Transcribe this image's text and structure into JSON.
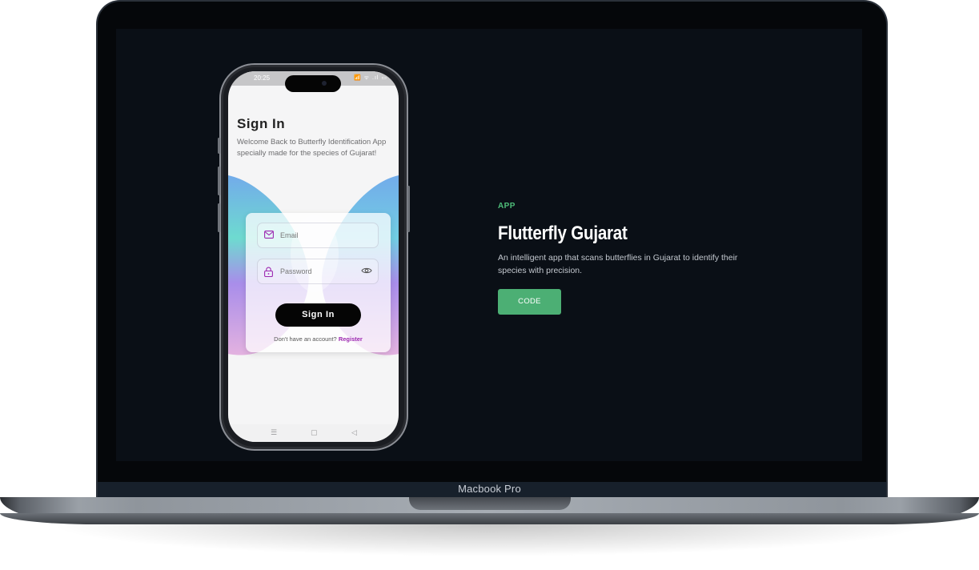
{
  "laptop": {
    "model_label": "Macbook Pro"
  },
  "phone": {
    "status_time": "20:25",
    "status_icons": "📶 ᯤ .ıl ▭",
    "signin_title": "Sign In",
    "signin_subtitle": "Welcome Back to Butterfly Identification App specially made for the species of Gujarat!",
    "email_placeholder": "Email",
    "password_placeholder": "Password",
    "signin_button": "Sign In",
    "no_account_text": "Don't have an account?",
    "register_link": "Register",
    "nav_icons": [
      "menu-icon",
      "home-square-icon",
      "back-triangle-icon"
    ]
  },
  "project": {
    "tag": "APP",
    "title": "Flutterfly Gujarat",
    "description": "An intelligent app that scans butterflies in Gujarat to identify their species with precision.",
    "code_button": "CODE"
  },
  "colors": {
    "accent_green": "#4caf74",
    "screen_bg": "#0a0f16",
    "register_purple": "#9c27b0"
  }
}
